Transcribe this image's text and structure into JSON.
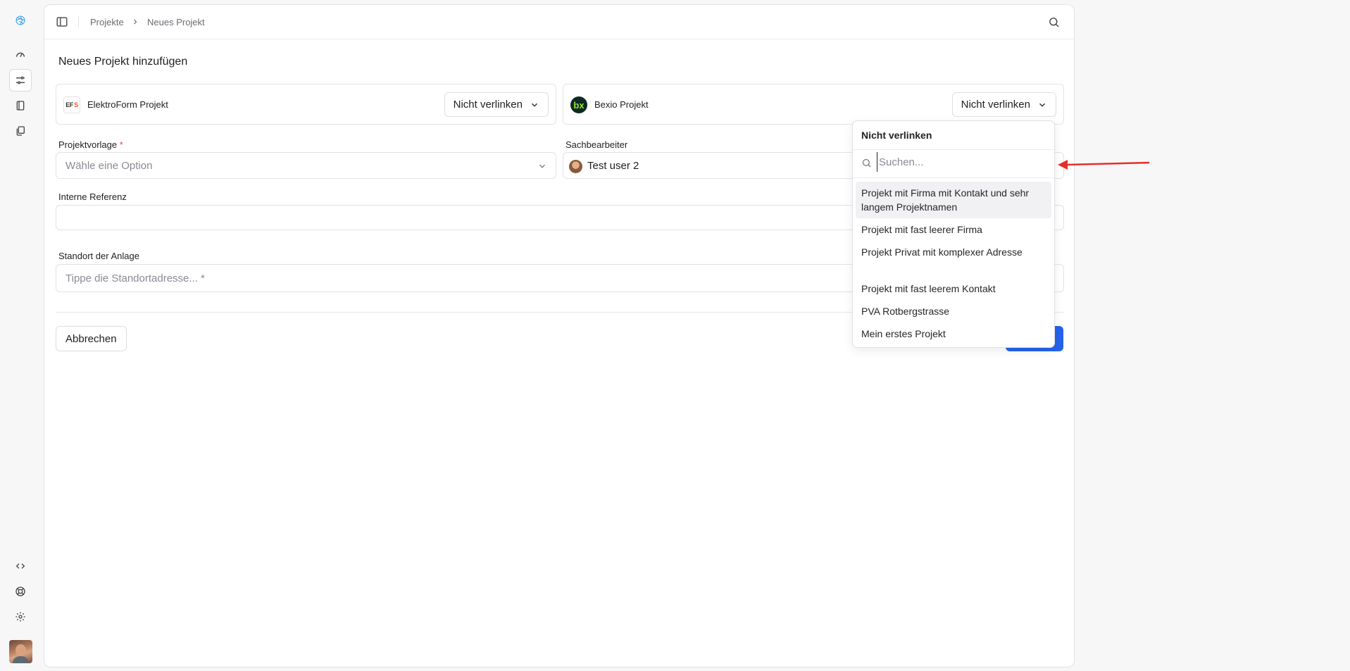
{
  "breadcrumb": [
    "Projekte",
    "Neues Projekt"
  ],
  "page_title": "Neues Projekt hinzufügen",
  "cards": [
    {
      "label": "ElektroForm Projekt",
      "logo": "EF S",
      "select": "Nicht verlinken"
    },
    {
      "label": "Bexio Projekt",
      "logo": "bx",
      "select": "Nicht verlinken"
    }
  ],
  "fields": {
    "projektvorlage": {
      "label": "Projektvorlage",
      "required": "*",
      "placeholder": "Wähle eine Option"
    },
    "sachbearbeiter": {
      "label": "Sachbearbeiter",
      "value": "Test user 2"
    },
    "interne_referenz": {
      "label": "Interne Referenz",
      "value": ""
    },
    "standort": {
      "label": "Standort der Anlage",
      "placeholder": "Tippe die Standortadresse... *"
    }
  },
  "buttons": {
    "cancel": "Abbrechen"
  },
  "dropdown": {
    "header": "Nicht verlinken",
    "search_placeholder": "Suchen...",
    "items": [
      "Projekt mit Firma mit Kontakt und sehr langem Projektnamen",
      "Projekt mit fast leerer Firma",
      "Projekt Privat mit komplexer Adresse",
      "Projekt mit fast leerem Kontakt",
      "PVA Rotbergstrasse",
      "Mein erstes Projekt"
    ]
  },
  "colors": {
    "accent": "#2563eb",
    "annotation_arrow": "#e5302a",
    "required": "#e5484d"
  }
}
